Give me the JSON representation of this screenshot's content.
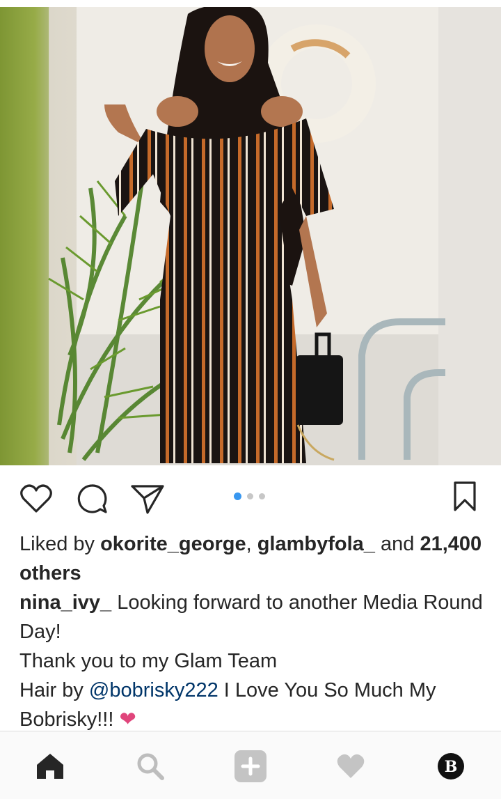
{
  "post": {
    "image_alt": "woman in striped off-shoulder jumpsuit",
    "carousel": {
      "count": 3,
      "active_index": 0
    }
  },
  "likes": {
    "prefix": "Liked by",
    "user1": "okorite_george",
    "separator": ",",
    "user2": "glambyfola_",
    "conjunction": "and",
    "others": "21,400 others"
  },
  "caption": {
    "username": "nina_ivy_",
    "line1": "Looking forward to another Media Round Day!",
    "line2": "Thank you to my Glam Team",
    "line3_prefix": "Hair by",
    "mention": "@bobrisky222",
    "line3_suffix": "I Love You So Much My Bobrisky!!!",
    "emoji": "❤"
  },
  "colors": {
    "accent_blue": "#3897f0",
    "mention": "#003569",
    "emoji_heart": "#e0457b"
  },
  "icons": {
    "like": "heart-outline-icon",
    "comment": "comment-bubble-icon",
    "share": "paper-plane-icon",
    "save": "bookmark-icon"
  },
  "nav": [
    {
      "name": "home",
      "icon": "home-icon",
      "active": true
    },
    {
      "name": "search",
      "icon": "search-icon"
    },
    {
      "name": "new-post",
      "icon": "plus-square-icon"
    },
    {
      "name": "activity",
      "icon": "heart-icon"
    },
    {
      "name": "profile",
      "icon": "avatar-icon",
      "avatar_letter": "B"
    }
  ]
}
